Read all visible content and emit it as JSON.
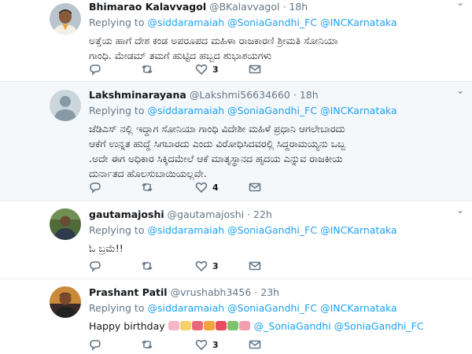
{
  "tweets": [
    {
      "display_name": "Bhimarao Kalavvagol",
      "handle": "@BKalavvagol",
      "dot": "·",
      "time": "18h",
      "replying_to": "Replying to",
      "mentions": [
        "@siddaramaiah",
        "@SoniaGandhi_FC",
        "@INCKarnataka"
      ],
      "text_lines": [
        "ಅತ್ತೆಯ ಹಾಗೆ ದೇಶ ಕಂಡ ಅಪರೂಪದ ಮಹಿಳಾ ರಾಜಕಾರಣಿ ಶ್ರೀಮತಿ ಸೋನಿಯಾ",
        "ಗಾಂಧಿ.  ಮೇಡಮ್ ತಮಗೆ ಹುಟ್ಟಿದ ಹಬ್ಬದ ಶುಭಾಶಯಗಳು"
      ],
      "likes": "3"
    },
    {
      "display_name": "Lakshminarayana",
      "handle": "@Lakshmi56634660",
      "dot": "·",
      "time": "18h",
      "replying_to": "Replying to",
      "mentions": [
        "@siddaramaiah",
        "@SoniaGandhi_FC",
        "@INCKarnataka"
      ],
      "text_lines": [
        "ಜೆಡಿಎಸ್ ನಲ್ಲಿ ಇದ್ದಾಗ ಸೋನಿಯಾ ಗಾಂಧಿ ವಿದೇಶೀ ಮಹಿಳೆ ಪ್ರಧಾನಿ ಆಗಲೇಬಾರದು",
        "ಆಕೆಗೆ ಉನ್ನತ ಹುದ್ದೆ ಸಿಗಬಾರದು ಎಂದು ವಿರೋಧಿಸಿದವರಲ್ಲಿ ಸಿದ್ದರಾಮಯ್ಯನು ಒಬ್ಬ",
        ".ಅದೇ ಈಗ ಅಧಿಕಾರ ಸಿಕ್ಕಿದಮೇಲೆ ಆಕೆ ಮಾತೃಸ್ಥಾನದ ಹೃದಯ ಎನ್ನುವ ರಾಜಕೀಯ",
        "ದುರ್ನಾತದ ಹೊಲಸುಬಾಯಿಯಲ್ಲವೇ."
      ],
      "likes": "4"
    },
    {
      "display_name": "gautamajoshi",
      "handle": "@gautamajoshi",
      "dot": "·",
      "time": "22h",
      "replying_to": "Replying to",
      "mentions": [
        "@siddaramaiah",
        "@SoniaGandhi_FC",
        "@INCKarnataka"
      ],
      "text_lines": [
        "ಓ ಬ್ರಮೆ!!"
      ],
      "likes": "3"
    },
    {
      "display_name": "Prashant Patil",
      "handle": "@vrushabh3456",
      "dot": "·",
      "time": "23h",
      "replying_to": "Replying to",
      "mentions": [
        "@siddaramaiah",
        "@SoniaGandhi_FC",
        "@INCKarnataka"
      ],
      "text_prefix": "Happy birthday",
      "text_links": [
        "@_SoniaGandhi",
        "@SoniaGandhi_FC"
      ],
      "emoji_icons": [
        "birthday-cake-icon",
        "cake-icon",
        "bouquet-icon",
        "party-popper-icon",
        "gift-icon",
        "bouquet-icon",
        "bouquet-icon"
      ],
      "likes": "3"
    }
  ],
  "colors": {
    "link": "#1da1f2",
    "secondary_text": "#657786",
    "highlight_bg": "#f5f8fa",
    "divider": "#e6ecf0"
  }
}
